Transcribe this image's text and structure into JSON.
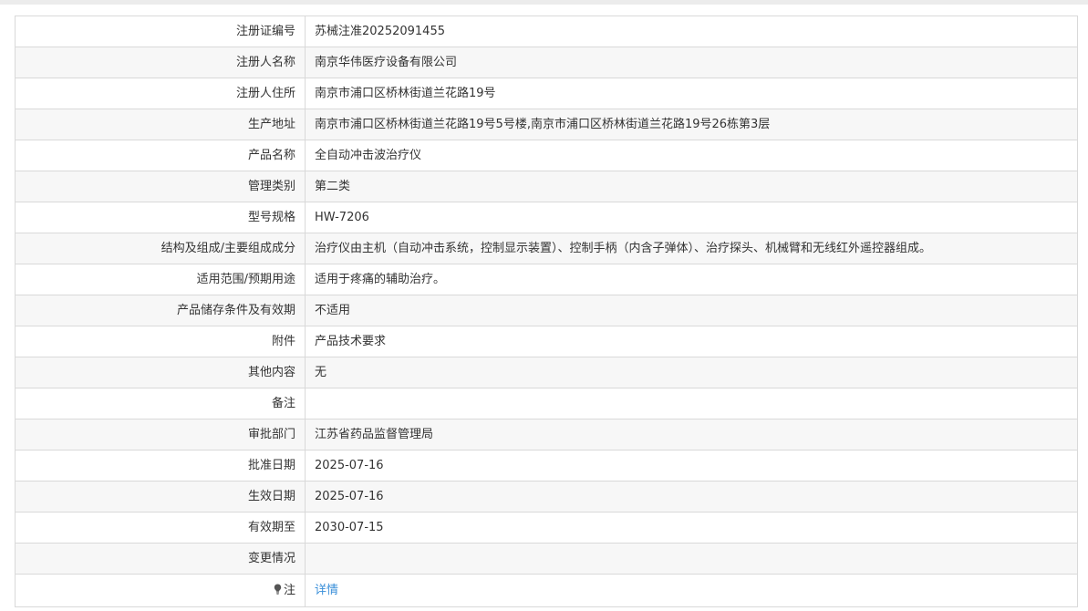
{
  "rows": [
    {
      "label": "注册证编号",
      "value": "苏械注准20252091455"
    },
    {
      "label": "注册人名称",
      "value": "南京华伟医疗设备有限公司"
    },
    {
      "label": "注册人住所",
      "value": "南京市浦口区桥林街道兰花路19号"
    },
    {
      "label": "生产地址",
      "value": "南京市浦口区桥林街道兰花路19号5号楼,南京市浦口区桥林街道兰花路19号26栋第3层"
    },
    {
      "label": "产品名称",
      "value": "全自动冲击波治疗仪"
    },
    {
      "label": "管理类别",
      "value": "第二类"
    },
    {
      "label": "型号规格",
      "value": "HW-7206"
    },
    {
      "label": "结构及组成/主要组成成分",
      "value": "治疗仪由主机（自动冲击系统，控制显示装置）、控制手柄（内含子弹体）、治疗探头、机械臂和无线红外遥控器组成。"
    },
    {
      "label": "适用范围/预期用途",
      "value": "适用于疼痛的辅助治疗。"
    },
    {
      "label": "产品储存条件及有效期",
      "value": "不适用"
    },
    {
      "label": "附件",
      "value": "产品技术要求"
    },
    {
      "label": "其他内容",
      "value": "无"
    },
    {
      "label": "备注",
      "value": ""
    },
    {
      "label": "审批部门",
      "value": "江苏省药品监督管理局"
    },
    {
      "label": "批准日期",
      "value": "2025-07-16"
    },
    {
      "label": "生效日期",
      "value": "2025-07-16"
    },
    {
      "label": "有效期至",
      "value": "2030-07-15"
    },
    {
      "label": "变更情况",
      "value": ""
    }
  ],
  "note": {
    "icon": "lightbulb-icon",
    "label": "注",
    "link_text": "详情"
  },
  "colors": {
    "link": "#3a8fd9",
    "border": "#d9d9d9",
    "alt_row": "#f7f7f7"
  }
}
